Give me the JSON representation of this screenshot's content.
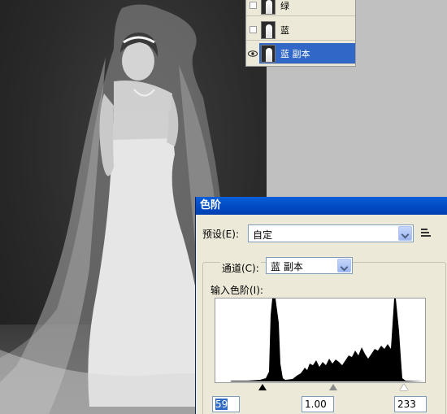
{
  "layers_panel": {
    "layers": [
      {
        "name": "绿",
        "visible": false,
        "selected": false
      },
      {
        "name": "蓝",
        "visible": false,
        "selected": false
      },
      {
        "name": "蓝 副本",
        "visible": true,
        "selected": true
      }
    ]
  },
  "levels_dialog": {
    "title": "色阶",
    "preset_label": "预设(E):",
    "preset_value": "自定",
    "channel_label": "通道(C):",
    "channel_value": "蓝 副本",
    "input_levels_label": "输入色阶(I):",
    "input_black": "59",
    "input_gamma": "1.00",
    "input_white": "233"
  },
  "colors": {
    "title_bar": "#0048c2",
    "selection": "#3167c6",
    "dialog_bg": "#ece9d8"
  }
}
